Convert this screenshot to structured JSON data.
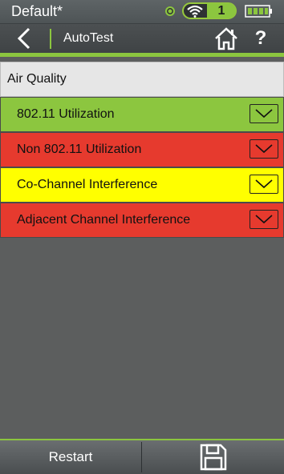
{
  "status": {
    "profile": "Default*",
    "wifi_count": "1",
    "colors": {
      "accent": "#8cc63f",
      "ok": "#8cc63f"
    }
  },
  "header": {
    "title": "AutoTest",
    "help_label": "?"
  },
  "section": {
    "title": "Air Quality"
  },
  "tests": [
    {
      "label": "802.11 Utilization",
      "status": "pass",
      "color": "#8cc63f"
    },
    {
      "label": "Non 802.11 Utilization",
      "status": "fail",
      "color": "#e63a2e"
    },
    {
      "label": "Co-Channel Interference",
      "status": "warning",
      "color": "#ffff00"
    },
    {
      "label": "Adjacent Channel Interference",
      "status": "fail",
      "color": "#e63a2e"
    }
  ],
  "footer": {
    "restart_label": "Restart",
    "save_icon": "floppy-disk-icon"
  }
}
